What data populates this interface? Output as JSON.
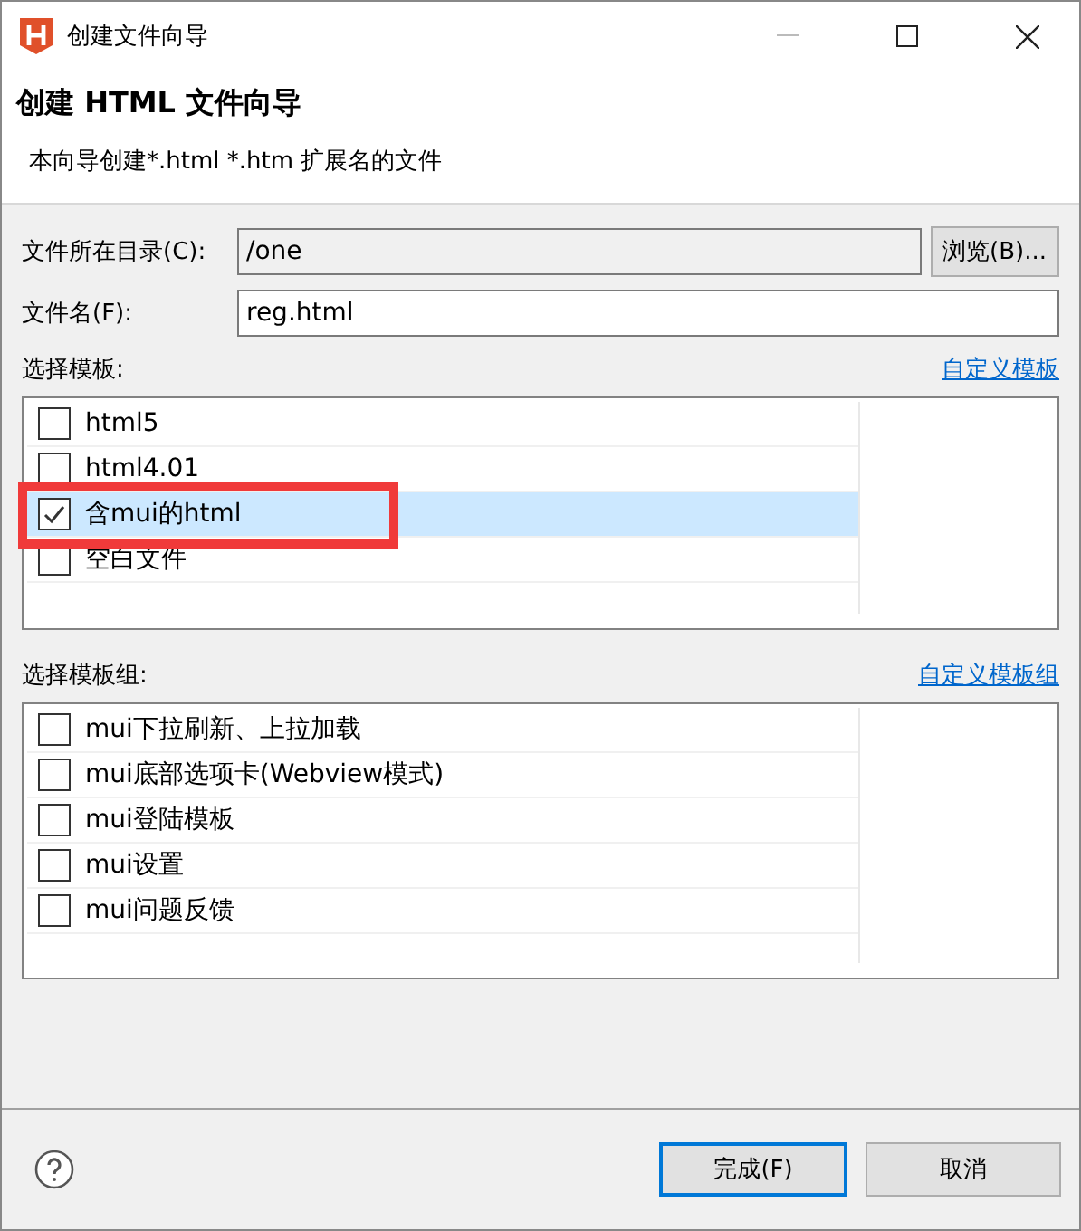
{
  "window": {
    "title": "创建文件向导"
  },
  "header": {
    "title": "创建 HTML 文件向导",
    "description": "本向导创建*.html *.htm 扩展名的文件"
  },
  "directory": {
    "label": "文件所在目录(C):",
    "value": "/one",
    "browse_button": "浏览(B)..."
  },
  "filename": {
    "label": "文件名(F):",
    "value": "reg.html"
  },
  "templates": {
    "label": "选择模板:",
    "link": "自定义模板",
    "items": [
      {
        "label": "html5",
        "checked": false,
        "selected": false
      },
      {
        "label": "html4.01",
        "checked": false,
        "selected": false
      },
      {
        "label": "含mui的html",
        "checked": true,
        "selected": true
      },
      {
        "label": "空白文件",
        "checked": false,
        "selected": false
      }
    ]
  },
  "template_groups": {
    "label": "选择模板组:",
    "link": "自定义模板组",
    "items": [
      {
        "label": "mui下拉刷新、上拉加载",
        "checked": false,
        "selected": false
      },
      {
        "label": "mui底部选项卡(Webview模式)",
        "checked": false,
        "selected": false
      },
      {
        "label": "mui登陆模板",
        "checked": false,
        "selected": false
      },
      {
        "label": "mui设置",
        "checked": false,
        "selected": false
      },
      {
        "label": "mui问题反馈",
        "checked": false,
        "selected": false
      }
    ]
  },
  "buttons": [
    "完成(F)",
    "取消"
  ]
}
